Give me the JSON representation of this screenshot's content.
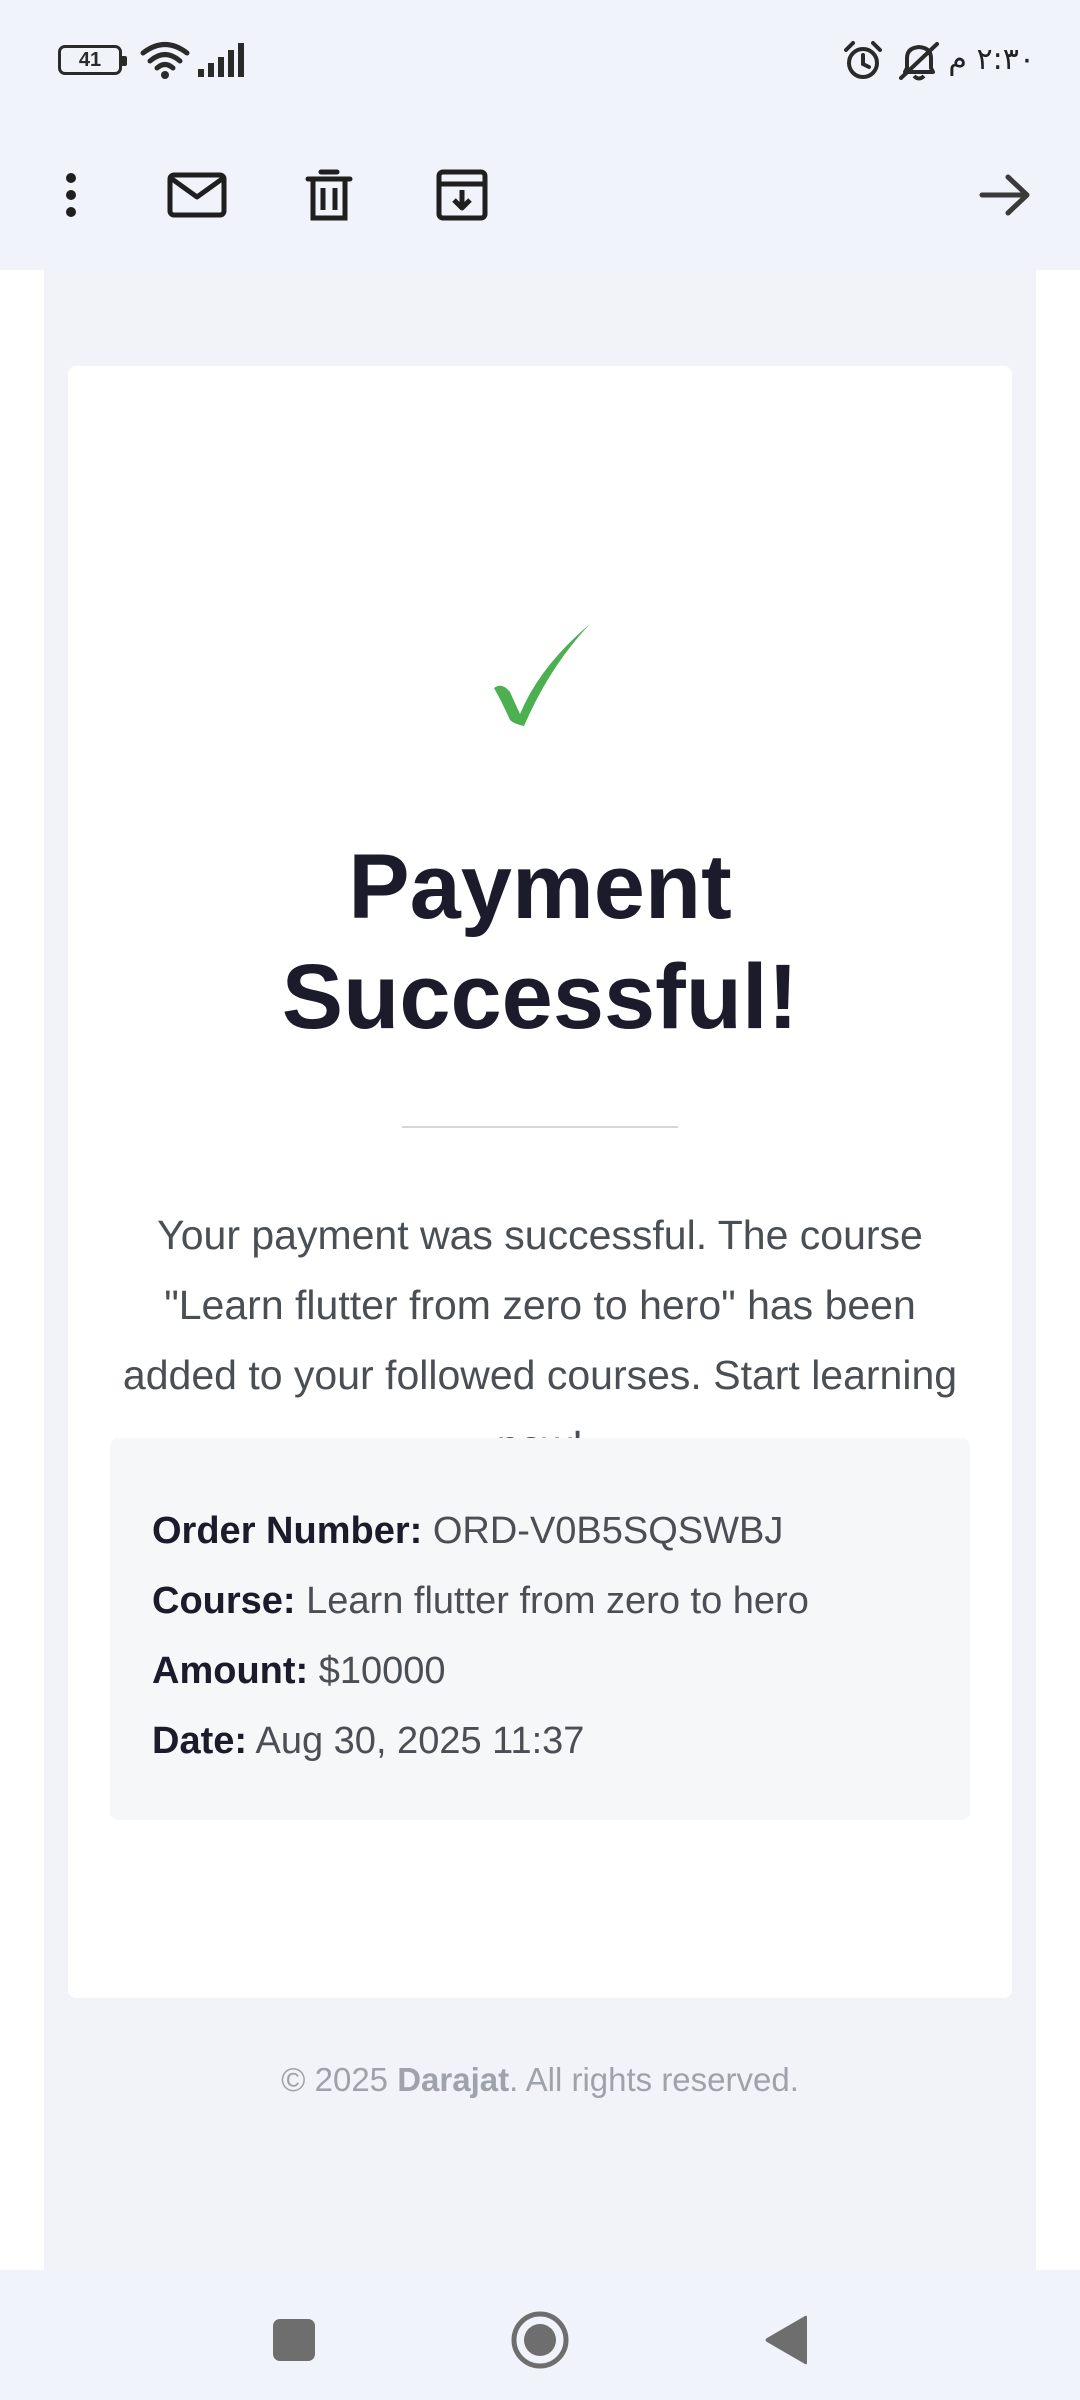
{
  "status_bar": {
    "battery_level": "41",
    "time": "٢:٣٠ م",
    "icons": [
      "battery-icon",
      "wifi-icon",
      "signal-icon",
      "alarm-icon",
      "bell-off-icon"
    ]
  },
  "toolbar": {
    "icons": [
      "more-vert-icon",
      "mail-icon",
      "delete-icon",
      "archive-icon",
      "arrow-forward-icon"
    ]
  },
  "email": {
    "check_icon": "checkmark-icon",
    "title": "Payment Successful!",
    "message": "Your payment was successful. The course \"Learn flutter from zero to hero\" has been added to your followed courses. Start learning now!",
    "details": [
      {
        "label": "Order Number:",
        "value": "ORD-V0B5SQSWBJ"
      },
      {
        "label": "Course:",
        "value": "Learn flutter from zero to hero"
      },
      {
        "label": "Amount:",
        "value": "$10000"
      },
      {
        "label": "Date:",
        "value": "Aug 30, 2025 11:37"
      }
    ],
    "footer": {
      "prefix": "© 2025 ",
      "brand": "Darajat",
      "suffix": ". All rights reserved."
    },
    "colors": {
      "check": "#4caf50",
      "title": "#1c1b2b",
      "text": "#4a4e55"
    }
  },
  "nav_bar": {
    "icons": [
      "recents-square-icon",
      "home-circle-icon",
      "back-triangle-icon"
    ]
  }
}
